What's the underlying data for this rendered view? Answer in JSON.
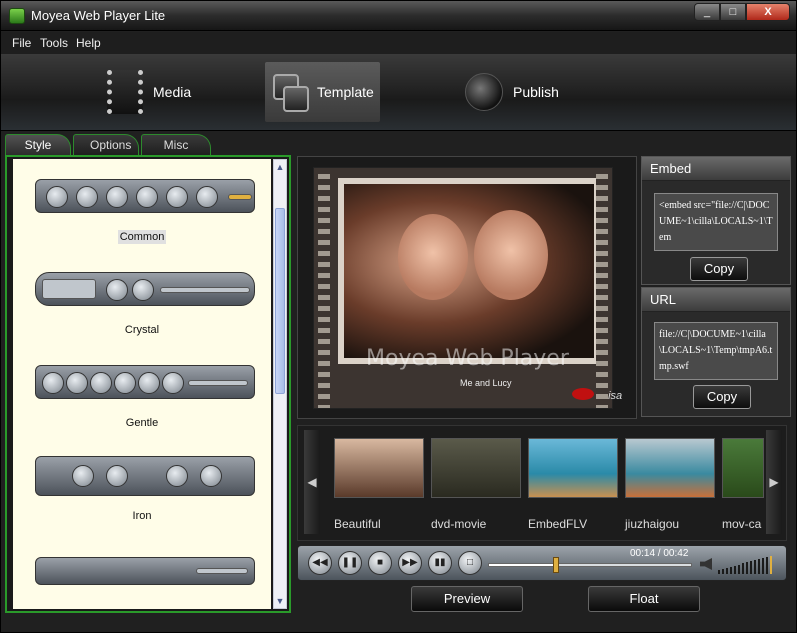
{
  "window": {
    "title": "Moyea Web Player Lite",
    "min_label": "_",
    "max_label": "□",
    "close_label": "X"
  },
  "menu": {
    "items": [
      "File",
      "Tools",
      "Help"
    ]
  },
  "nav": {
    "items": [
      {
        "label": "Media",
        "icon": "film-icon"
      },
      {
        "label": "Template",
        "icon": "template-icon",
        "active": true
      },
      {
        "label": "Publish",
        "icon": "publish-icon"
      }
    ]
  },
  "tabs": [
    "Style",
    "Options",
    "Misc"
  ],
  "styles": [
    "Common",
    "Crystal",
    "Gentle",
    "Iron"
  ],
  "preview": {
    "watermark": "Moyea Web Player",
    "caption": "Me and Lucy",
    "signature": "Lisa"
  },
  "embed": {
    "title": "Embed",
    "code": "<embed src=\"file://C|\\DOCUME~1\\cilla\\LOCALS~1\\Tem",
    "copy_label": "Copy"
  },
  "url": {
    "title": "URL",
    "value": "file://C|\\DOCUME~1\\cilla\\LOCALS~1\\Temp\\tmpA6.tmp.swf",
    "copy_label": "Copy"
  },
  "thumbnails": [
    "Beautiful",
    "dvd-movie",
    "EmbedFLV",
    "jiuzhaigou",
    "mov-ca"
  ],
  "player": {
    "time": "00:14 / 00:42",
    "progress": 0.33,
    "volume": 1.0
  },
  "buttons": {
    "preview": "Preview",
    "float": "Float"
  },
  "colors": {
    "tab_border": "#2a9a2a",
    "seek_knob": "#e0b040",
    "list_bg": "#fffde8"
  }
}
